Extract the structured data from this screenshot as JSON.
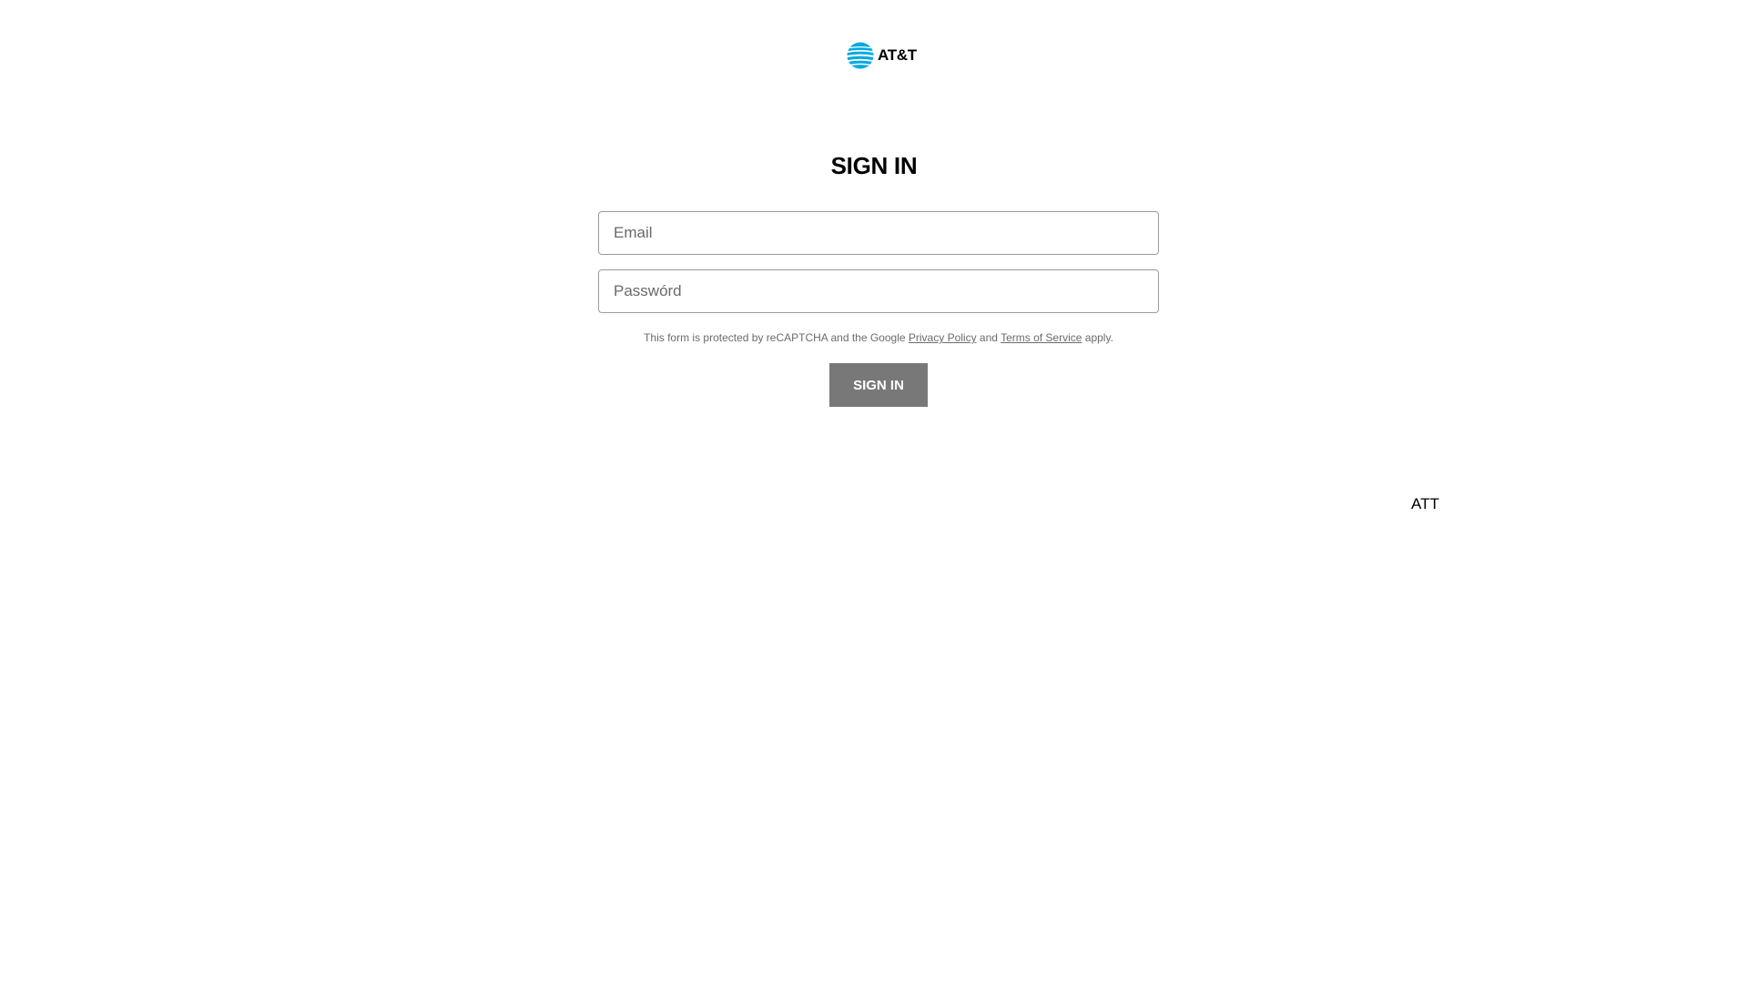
{
  "brand": {
    "logo_text": "AT&T",
    "logo_accent_color": "#00a8e0",
    "logo_icon": "att-globe-icon"
  },
  "form": {
    "title": "SIGN IN",
    "email_placeholder": "Email",
    "password_placeholder": "Passwórd",
    "recaptcha": {
      "prefix": "This form is protected by reCAPTCHA and the Google",
      "privacy_link": "Privacy Policy",
      "and_text": "and",
      "terms_link": "Terms of Service",
      "suffix": "apply."
    },
    "submit_label": "SIGN IN",
    "submit_color": "#787878"
  },
  "footer": {
    "brand_text": "ATT"
  }
}
